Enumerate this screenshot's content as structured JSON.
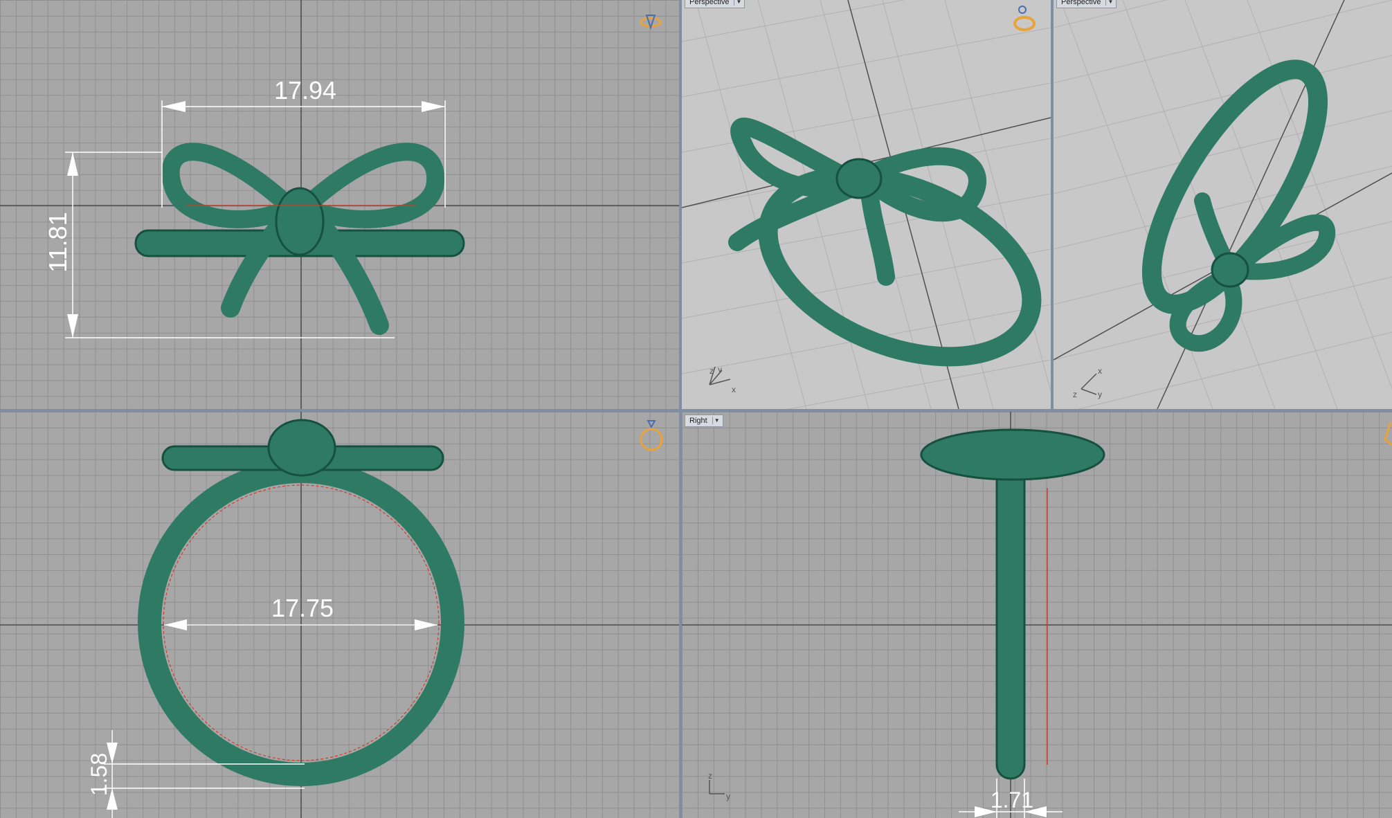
{
  "colors": {
    "ring": "#2f7a62",
    "ring_dark": "#16503e",
    "ring_light": "#5fae92",
    "grid_bg": "#a7a7a7",
    "dimension": "#ffffff",
    "accent_red": "#d23b2b",
    "gizmo": "#e8a33a"
  },
  "viewports": {
    "top_left": {
      "dim_width": "17.94",
      "dim_height": "11.81",
      "gizmo_icon": "ring-gizmo-icon"
    },
    "top_middle": {
      "label": "Perspective",
      "axis_icon": "xyz-axis-icon",
      "gizmo_icon": "ring-gizmo-icon"
    },
    "top_right": {
      "label": "Perspective",
      "axis_icon": "xyz-axis-icon"
    },
    "bottom_left": {
      "dim_diameter": "17.75",
      "dim_thickness": "1.58",
      "gizmo_icon": "ring-gizmo-icon"
    },
    "bottom_right": {
      "label": "Right",
      "dim_width": "1.71",
      "axis_icon": "zy-axis-icon"
    }
  },
  "axis_letters": {
    "x": "x",
    "y": "y",
    "z": "z"
  }
}
